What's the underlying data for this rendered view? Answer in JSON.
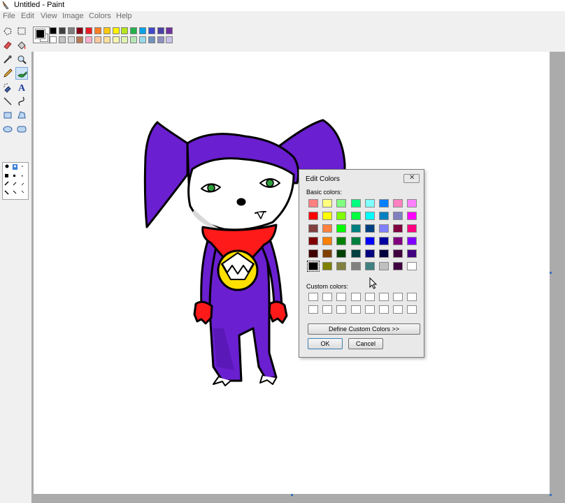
{
  "window": {
    "title": "Untitled - Paint"
  },
  "menu": {
    "items": [
      "File",
      "Edit",
      "View",
      "Image",
      "Colors",
      "Help"
    ]
  },
  "tools": [
    {
      "name": "free-form-select"
    },
    {
      "name": "rect-select"
    },
    {
      "name": "eraser"
    },
    {
      "name": "fill"
    },
    {
      "name": "pick-color"
    },
    {
      "name": "magnifier"
    },
    {
      "name": "pencil"
    },
    {
      "name": "brush",
      "active": true
    },
    {
      "name": "airbrush"
    },
    {
      "name": "text"
    },
    {
      "name": "line"
    },
    {
      "name": "curve"
    },
    {
      "name": "rectangle"
    },
    {
      "name": "polygon"
    },
    {
      "name": "ellipse"
    },
    {
      "name": "rounded-rectangle"
    }
  ],
  "palette": {
    "foreground": "#000000",
    "background": "#ffffff",
    "top_row": [
      "#000000",
      "#404040",
      "#7f7f7f",
      "#880015",
      "#ed1c24",
      "#ff7f27",
      "#ffc90e",
      "#fff200",
      "#b5e61d",
      "#22b14c",
      "#00a2e8",
      "#3f48cc",
      "#4b3fa8",
      "#7030a0"
    ],
    "bottom_row": [
      "#ffffff",
      "#c3c3c3",
      "#d8d8d8",
      "#b97a57",
      "#ffaec9",
      "#ffc9a0",
      "#ffe0a0",
      "#f5f5b0",
      "#e0f5b0",
      "#b5e6b5",
      "#99d9ea",
      "#7092be",
      "#9090c0",
      "#c8bfe7"
    ]
  },
  "edit_colors_dialog": {
    "title": "Edit Colors",
    "close_symbol": "✕",
    "basic_colors_label": "Basic colors:",
    "custom_colors_label": "Custom colors:",
    "basic_colors": [
      [
        "#ff8080",
        "#ffff80",
        "#80ff80",
        "#00ff80",
        "#80ffff",
        "#0080ff",
        "#ff80c0",
        "#ff80ff"
      ],
      [
        "#ff0000",
        "#ffff00",
        "#80ff00",
        "#00ff40",
        "#00ffff",
        "#0080c0",
        "#8080c0",
        "#ff00ff"
      ],
      [
        "#804040",
        "#ff8040",
        "#00ff00",
        "#008080",
        "#004080",
        "#8080ff",
        "#800040",
        "#ff0080"
      ],
      [
        "#800000",
        "#ff8000",
        "#008000",
        "#008040",
        "#0000ff",
        "#0000a0",
        "#800080",
        "#8000ff"
      ],
      [
        "#400000",
        "#804000",
        "#004000",
        "#004040",
        "#000080",
        "#000040",
        "#400040",
        "#400080"
      ],
      [
        "#000000",
        "#808000",
        "#808040",
        "#808080",
        "#408080",
        "#c0c0c0",
        "#400040",
        "#ffffff"
      ]
    ],
    "selected_color": "#000000",
    "custom_colors_count": 16,
    "define_custom_label": "Define Custom Colors >>",
    "ok_label": "OK",
    "cancel_label": "Cancel"
  }
}
